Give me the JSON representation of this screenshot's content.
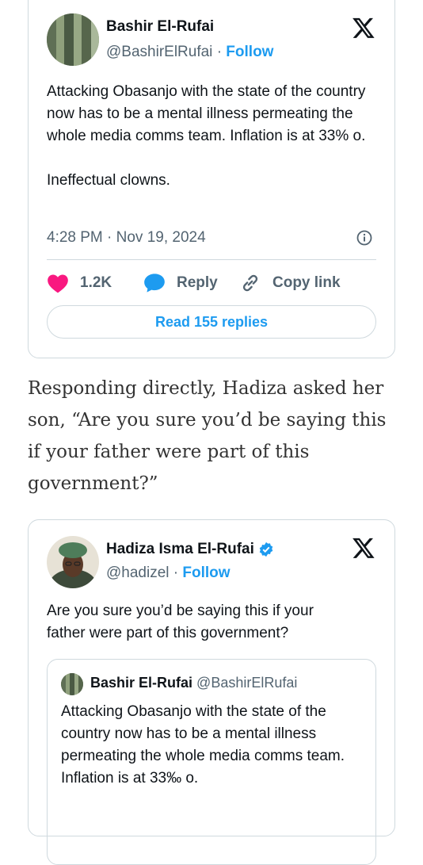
{
  "tweet1": {
    "author_name": "Bashir El-Rufai",
    "handle": "@BashirElRufai",
    "separator": "·",
    "follow_label": "Follow",
    "text": "Attacking Obasanjo with the state of the country now has to be a mental illness permeating the whole media comms team. Inflation is at 33% o.\n\nIneffectual clowns.",
    "timestamp": "4:28 PM · Nov 19, 2024",
    "like_count": "1.2K",
    "reply_label": "Reply",
    "copy_link_label": "Copy link",
    "read_replies_label": "Read 155 replies",
    "logo": "x-logo-icon"
  },
  "article": {
    "paragraph": "Responding directly, Hadiza asked her son, “Are you sure you’d be saying this if your father were part of this government?”"
  },
  "tweet2": {
    "author_name": "Hadiza Isma El-Rufai",
    "handle": "@hadizel",
    "separator": "·",
    "follow_label": "Follow",
    "verified_icon": "verified-badge-icon",
    "text": "Are you sure you’d be saying this if your father were part of this government?",
    "quoted": {
      "author_name": "Bashir El-Rufai",
      "handle": "@BashirElRufai",
      "text": "Attacking Obasanjo with the state of the country now has to be a mental illness permeating the whole media comms team. Inflation is at 33‰ o."
    }
  },
  "colors": {
    "accent": "#1d9bf0",
    "like": "#f91880",
    "muted": "#536471",
    "border": "#cfd9de"
  }
}
